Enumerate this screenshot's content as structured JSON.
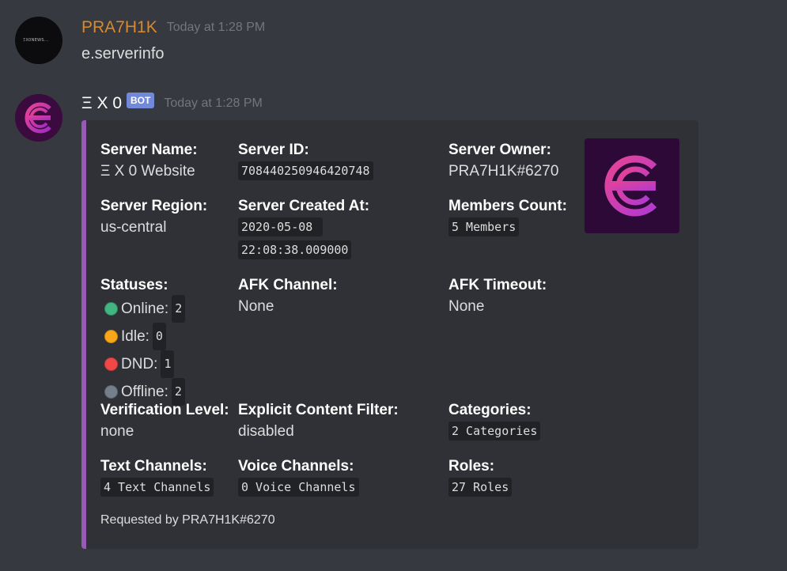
{
  "messages": [
    {
      "author": "PRA7H1K",
      "timestamp": "Today at 1:28 PM",
      "content": "e.serverinfo",
      "avatar_text": "ΞX0NEWS..."
    },
    {
      "author": "Ξ X 0",
      "badge": "BOT",
      "timestamp": "Today at 1:28 PM"
    }
  ],
  "embed": {
    "accent_color": "#9b59b6",
    "fields": {
      "server_name": {
        "name": "Server Name:",
        "value": "Ξ X 0 Website"
      },
      "server_id": {
        "name": "Server ID:",
        "value": "708440250946420748"
      },
      "server_owner": {
        "name": "Server Owner:",
        "value": "PRA7H1K#6270"
      },
      "server_region": {
        "name": "Server Region:",
        "value": "us-central"
      },
      "server_created": {
        "name": "Server Created At:",
        "value_line1": "2020-05-08 ",
        "value_line2": "22:08:38.009000"
      },
      "members_count": {
        "name": "Members Count:",
        "value": "5 Members"
      },
      "statuses": {
        "name": "Statuses:",
        "online_label": "Online:",
        "online_count": "2",
        "idle_label": "Idle:",
        "idle_count": "0",
        "dnd_label": "DND:",
        "dnd_count": "1",
        "offline_label": "Offline:",
        "offline_count": "2"
      },
      "afk_channel": {
        "name": "AFK Channel:",
        "value": "None"
      },
      "afk_timeout": {
        "name": "AFK Timeout:",
        "value": "None"
      },
      "verification_level": {
        "name": "Verification Level:",
        "value": "none"
      },
      "explicit_filter": {
        "name": "Explicit Content Filter:",
        "value": "disabled"
      },
      "categories": {
        "name": "Categories:",
        "value": "2 Categories"
      },
      "text_channels": {
        "name": "Text Channels:",
        "value": "4 Text Channels"
      },
      "voice_channels": {
        "name": "Voice Channels:",
        "value": "0 Voice Channels"
      },
      "roles": {
        "name": "Roles:",
        "value": "27 Roles"
      }
    },
    "footer": "Requested by PRA7H1K#6270"
  }
}
